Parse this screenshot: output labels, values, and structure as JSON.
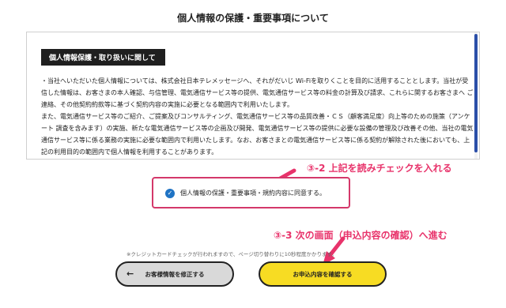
{
  "page": {
    "title": "個人情報の保護・重要事項について"
  },
  "content": {
    "section_heading": "個人情報保護・取り扱いに関して",
    "paragraphs": [
      "・当社へいただいた個人情報については、株式会社日本テレメッセージへ、それがだいじ Wi-Fiを取りくことを目的に活用することとします。当社が受信した情報は、お客さまの本人確認、与信管理、電気通信サービス等の提供、電気通信サービス等の料金の計算及び請求、これらに関するお客さまへ ご連絡、その他契約約款等に基づく契約内容の実施に必要となる範囲内で利用いたします。",
      "また、電気通信サービス等のご紹介、ご提案及びコンサルティング、電気通信サービス等の品質改善・ＣＳ（顧客満足度）向上等のための施策（アンケート 調査を含みます）の実施、新たな電気通信サービス等の企画及び開発、電気通信サービス等の提供に必要な設備の管理及び改善その他、当社の電気通信サービス等に係る業務の実施に必要な範囲内で利用いたします。なお、お客さまとの電気通信サービス等に係る契約が解除された後においても、上記の利用目的の範囲内で個人情報を利用することがあります。"
    ]
  },
  "consent": {
    "label": "個人情報の保護・重要事項・規約内容に同意する。",
    "checked": true
  },
  "annotations": {
    "step_2": "③-2 上記を読みチェックを入れる",
    "step_3": "③-3 次の画面（申込内容の確認）へ進む"
  },
  "notice": "※クレジットカードチェックが行われますので、ページ切り替わりに10秒程度かかります。",
  "buttons": {
    "back_label": "お客様情報を修正する",
    "back_icon": "←",
    "next_label": "お申込内容を確認する"
  },
  "colors": {
    "highlight": "#e8336b",
    "consent_border": "#d4386a",
    "checkbox": "#1f73c4",
    "next_button": "#f7dc23",
    "back_button": "#d9d9d9"
  }
}
